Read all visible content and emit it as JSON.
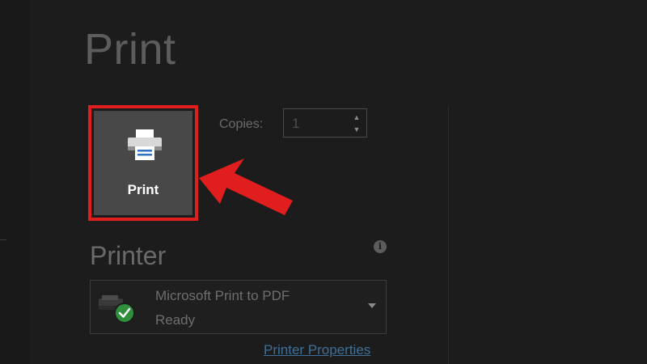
{
  "page": {
    "title": "Print"
  },
  "print_button": {
    "label": "Print",
    "icon": "printer-icon",
    "highlight_color": "#e01e1e"
  },
  "copies": {
    "label": "Copies:",
    "value": "1"
  },
  "printer": {
    "heading": "Printer",
    "selected_name": "Microsoft Print to PDF",
    "selected_status": "Ready",
    "device_icon": "printer-ready-icon",
    "properties_link": "Printer Properties"
  },
  "annotation": {
    "arrow_color": "#e01e1e"
  },
  "colors": {
    "background": "#1c1c1c",
    "link": "#3f6f98",
    "status_ok": "#2f8f3a"
  }
}
